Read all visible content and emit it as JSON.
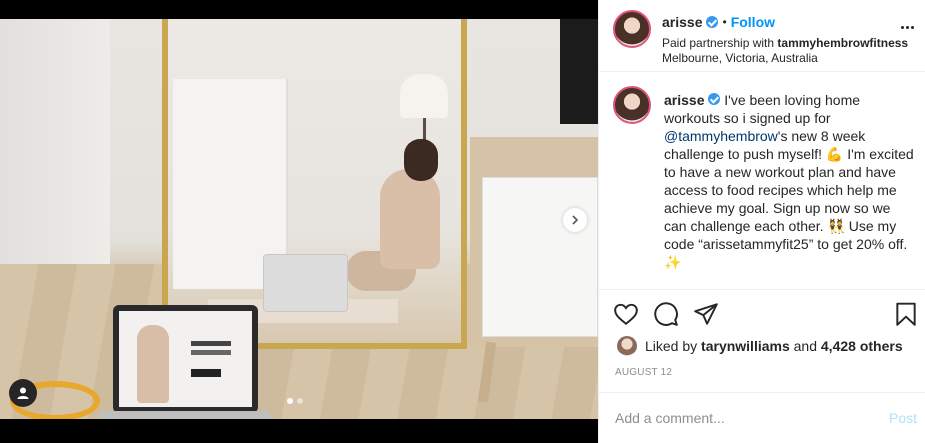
{
  "post": {
    "username": "arisse",
    "follow_label": "Follow",
    "separator": "•",
    "partnership_prefix": "Paid partnership with ",
    "partner": "tammyhembrowfitness",
    "location": "Melbourne, Victoria, Australia"
  },
  "caption": {
    "username": "arisse",
    "text_1": " I've been loving home workouts so i signed up for ",
    "mention": "@tammyhembrow",
    "text_2": "'s new 8 week challenge to push myself! 💪 I'm excited to have a new workout plan and have access to food recipes which help me achieve my goal. Sign up now so we can challenge each other. 👯 Use my code “arissetammyfit25” to get 20% off. ✨"
  },
  "likes": {
    "prefix": "Liked by ",
    "user": "tarynwilliams",
    "middle": " and ",
    "others": "4,428 others"
  },
  "date": "AUGUST 12",
  "comment": {
    "placeholder": "Add a comment...",
    "post_label": "Post"
  },
  "carousel": {
    "slide_count": 2,
    "active_slide": 1
  },
  "colors": {
    "accent_blue": "#0095f6",
    "verified_blue": "#3897f0",
    "post_disabled": "#b2dffc",
    "mirror_frame": "#c9a650"
  }
}
